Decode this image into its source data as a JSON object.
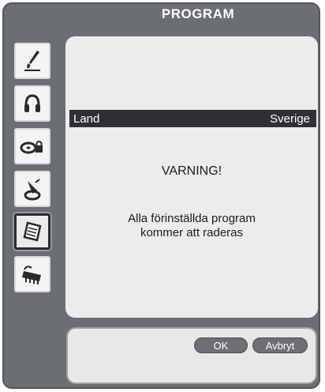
{
  "header": {
    "title": "PROGRAM"
  },
  "sidebar": {
    "items": [
      {
        "icon": "brush-icon"
      },
      {
        "icon": "headphones-icon"
      },
      {
        "icon": "disc-lock-icon"
      },
      {
        "icon": "satellite-dish-icon"
      },
      {
        "icon": "document-icon",
        "active": true
      },
      {
        "icon": "connector-icon"
      }
    ]
  },
  "setting": {
    "label": "Land",
    "value": "Sverige"
  },
  "warning": {
    "title": "VARNING!",
    "line1": "Alla förinställda program",
    "line2": "kommer att raderas"
  },
  "buttons": {
    "ok_label": "OK",
    "cancel_label": "Avbryt"
  },
  "colors": {
    "frame": "#6b6e72",
    "panel": "#ececec",
    "highlight_row": "#2e3033",
    "button": "#6d6f72"
  }
}
